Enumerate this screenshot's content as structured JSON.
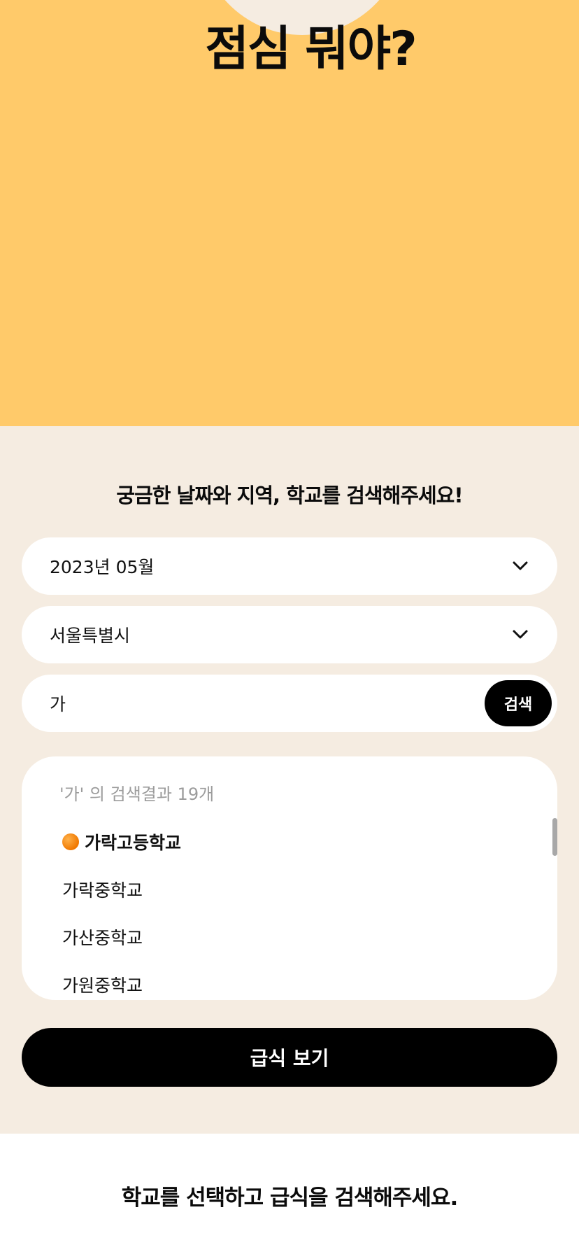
{
  "hero": {
    "title": "점심 뭐야?",
    "background": "#ffca6a"
  },
  "form": {
    "prompt": "궁금한 날짜와 지역, 학교를 검색해주세요!",
    "month_select": {
      "value": "2023년 05월",
      "icon": "chevron-down-icon"
    },
    "region_select": {
      "value": "서울특별시",
      "icon": "chevron-down-icon"
    },
    "school_search": {
      "value": "가",
      "button_label": "검색"
    },
    "results": {
      "summary": "'가' 의 검색결과 19개",
      "items": [
        {
          "label": "가락고등학교",
          "selected": true,
          "marker": "orange-dot-icon"
        },
        {
          "label": "가락중학교",
          "selected": false
        },
        {
          "label": "가산중학교",
          "selected": false
        },
        {
          "label": "가원중학교",
          "selected": false
        }
      ]
    },
    "submit_label": "급식 보기"
  },
  "footer": {
    "message": "학교를 선택하고 급식을 검색해주세요."
  },
  "colors": {
    "accent": "#ffca6a",
    "panel": "#f5ece1",
    "button": "#000000",
    "marker": "#f07800"
  }
}
